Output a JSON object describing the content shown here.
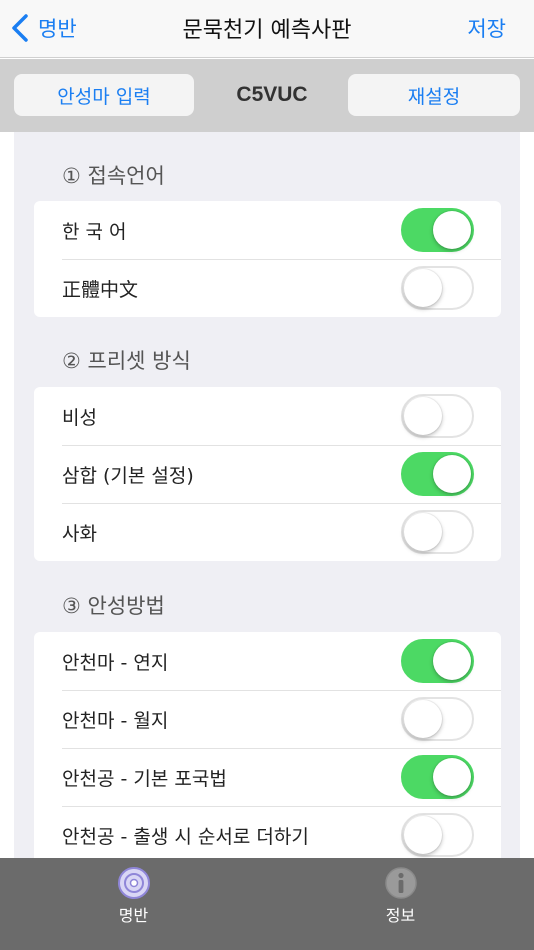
{
  "navbar": {
    "back_label": "명반",
    "title": "문묵천기 예측사판",
    "save_label": "저장"
  },
  "segment_bar": {
    "input_label": "안성마 입력",
    "code": "C5VUC",
    "reset_label": "재설정"
  },
  "sections": [
    {
      "header": "① 접속언어",
      "rows": [
        {
          "label": "한 국 어",
          "on": true
        },
        {
          "label": "正體中文",
          "on": false
        }
      ]
    },
    {
      "header": "② 프리셋 방식",
      "rows": [
        {
          "label": "비성",
          "on": false
        },
        {
          "label": "삼합 (기본 설정)",
          "on": true
        },
        {
          "label": "사화",
          "on": false
        }
      ]
    },
    {
      "header": "③ 안성방법",
      "rows": [
        {
          "label": "안천마 - 연지",
          "on": true
        },
        {
          "label": "안천마 - 월지",
          "on": false
        },
        {
          "label": "안천공 - 기본 포국법",
          "on": true
        },
        {
          "label": "안천공 - 출생 시 순서로 더하기",
          "on": false
        }
      ]
    }
  ],
  "tabbar": {
    "tabs": [
      {
        "label": "명반",
        "icon": "disc-icon"
      },
      {
        "label": "정보",
        "icon": "info-icon"
      }
    ]
  },
  "colors": {
    "accent": "#1a7ef2",
    "toggle_on": "#4cd964",
    "tabbar_bg": "#6b6b6b",
    "segment_bg": "#cfcfcf",
    "content_bg": "#efeff4"
  }
}
